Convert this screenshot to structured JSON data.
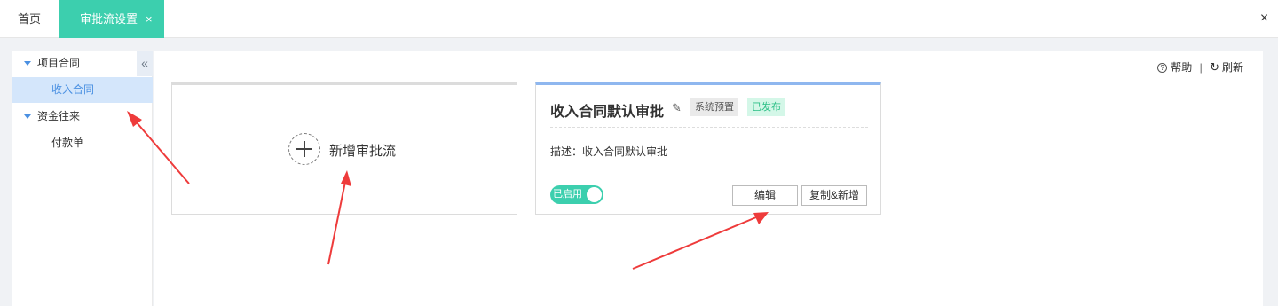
{
  "tabs": {
    "home_label": "首页",
    "active_label": "审批流设置",
    "active_close": "×",
    "window_close": "×"
  },
  "sidebar": {
    "collapse_glyph": "«",
    "groups": [
      {
        "label": "项目合同",
        "items": [
          {
            "label": "收入合同",
            "selected": true
          }
        ]
      },
      {
        "label": "资金往来",
        "items": [
          {
            "label": "付款单",
            "selected": false
          }
        ]
      }
    ]
  },
  "toolbar": {
    "help_glyph": "?",
    "help_label": "帮助",
    "separator": "|",
    "refresh_glyph": "↻",
    "refresh_label": "刷新"
  },
  "new_card": {
    "label": "新增审批流"
  },
  "flow_card": {
    "title": "收入合同默认审批",
    "edit_glyph": "✎",
    "tag_system": "系统预置",
    "tag_published": "已发布",
    "description": "描述：收入合同默认审批",
    "toggle_label": "已启用",
    "edit_button": "编辑",
    "copy_button": "复制&新增"
  },
  "colors": {
    "accent": "#3ccfae",
    "selected_bg": "#d4e6fb",
    "link_blue": "#4a90e2",
    "annotation_arrow": "#ee3b3b"
  }
}
